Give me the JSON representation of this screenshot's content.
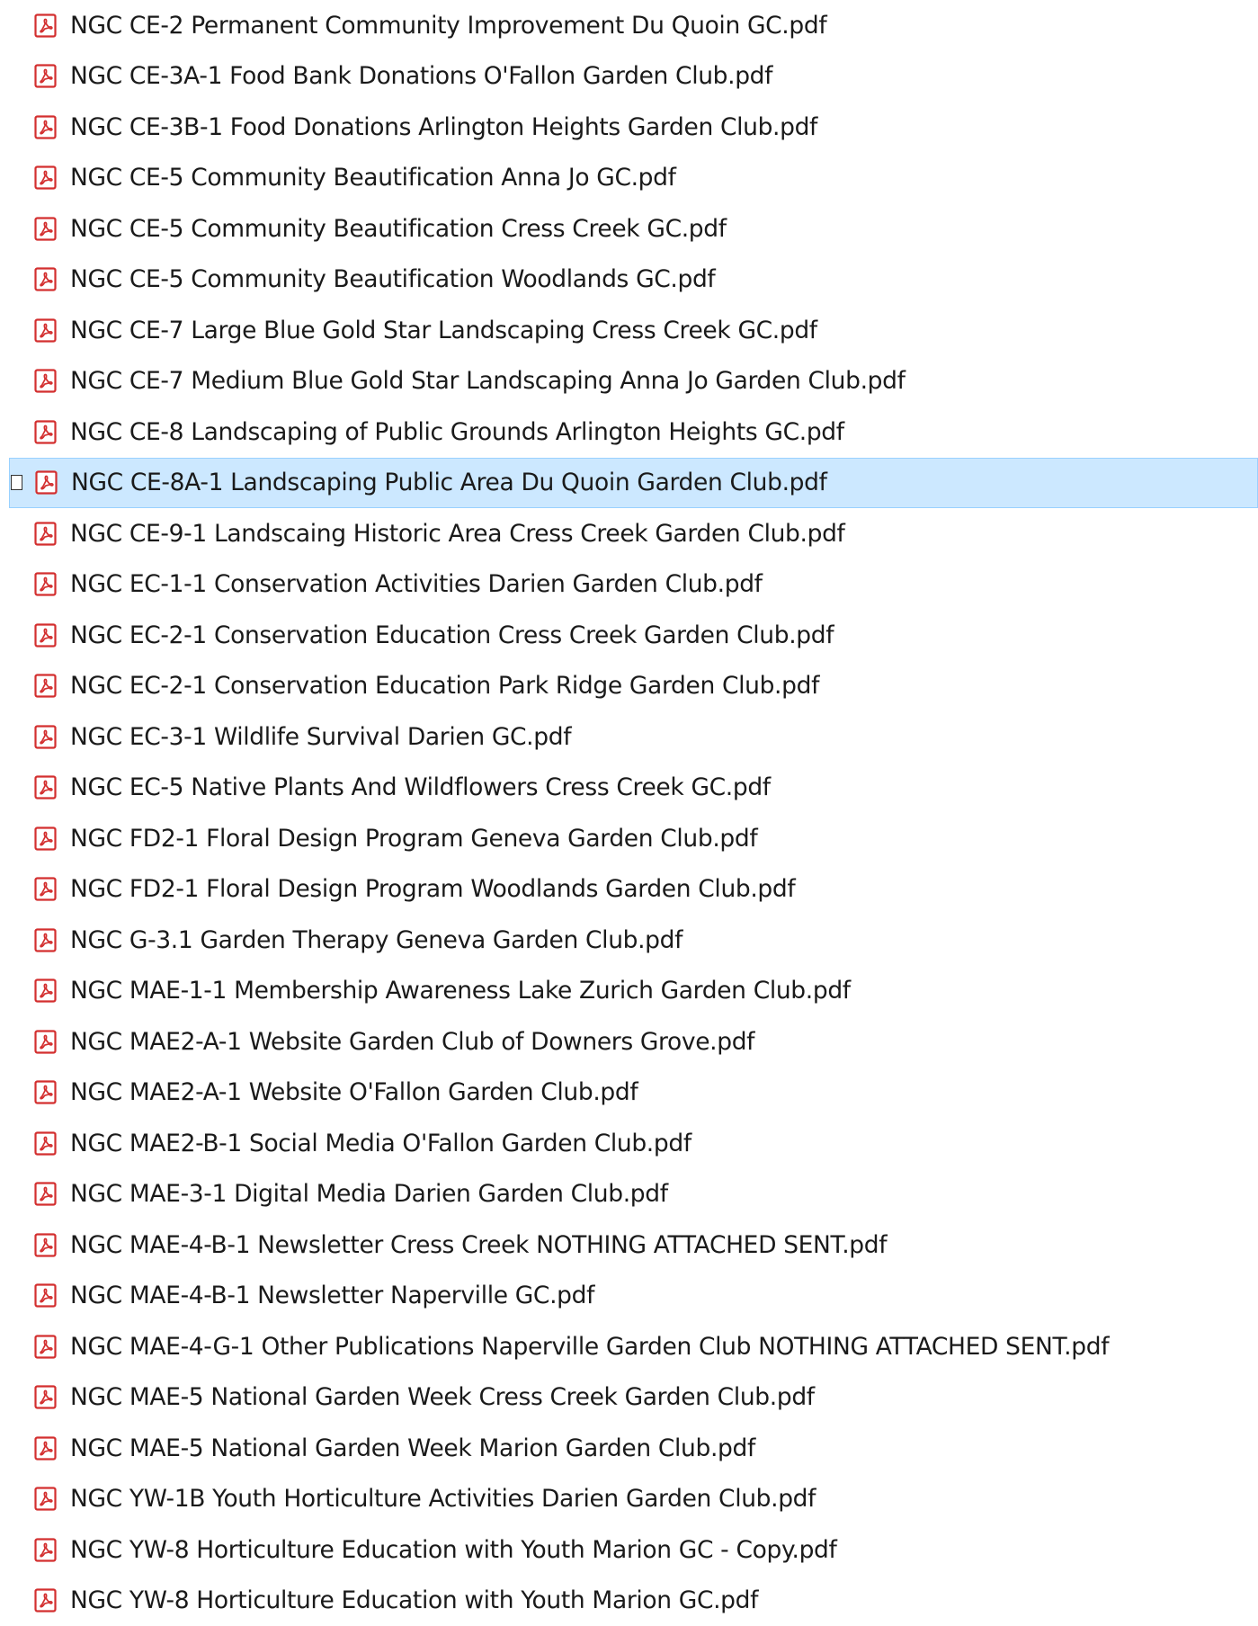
{
  "colors": {
    "selection_background": "#cce8ff",
    "selection_border": "#99d1ff",
    "pdf_icon": "#d32f2f",
    "text": "#1a1a1a"
  },
  "selected_index": 9,
  "files": [
    {
      "name": "NGC CE-2 Permanent Community Improvement Du Quoin GC.pdf",
      "icon": "pdf-icon"
    },
    {
      "name": "NGC CE-3A-1 Food Bank Donations O'Fallon Garden Club.pdf",
      "icon": "pdf-icon"
    },
    {
      "name": "NGC CE-3B-1 Food Donations Arlington Heights Garden Club.pdf",
      "icon": "pdf-icon"
    },
    {
      "name": "NGC CE-5 Community Beautification Anna Jo GC.pdf",
      "icon": "pdf-icon"
    },
    {
      "name": "NGC CE-5 Community Beautification Cress Creek GC.pdf",
      "icon": "pdf-icon"
    },
    {
      "name": "NGC CE-5 Community Beautification Woodlands GC.pdf",
      "icon": "pdf-icon"
    },
    {
      "name": "NGC CE-7 Large Blue Gold Star Landscaping Cress Creek GC.pdf",
      "icon": "pdf-icon"
    },
    {
      "name": "NGC CE-7 Medium Blue Gold Star Landscaping Anna Jo Garden Club.pdf",
      "icon": "pdf-icon"
    },
    {
      "name": "NGC CE-8 Landscaping of Public Grounds Arlington Heights GC.pdf",
      "icon": "pdf-icon"
    },
    {
      "name": "NGC CE-8A-1 Landscaping Public Area Du Quoin Garden Club.pdf",
      "icon": "pdf-icon"
    },
    {
      "name": "NGC CE-9-1 Landscaing Historic Area Cress Creek Garden Club.pdf",
      "icon": "pdf-icon"
    },
    {
      "name": "NGC EC-1-1 Conservation Activities Darien Garden Club.pdf",
      "icon": "pdf-icon"
    },
    {
      "name": "NGC EC-2-1 Conservation Education Cress Creek Garden Club.pdf",
      "icon": "pdf-icon"
    },
    {
      "name": "NGC EC-2-1 Conservation Education Park Ridge Garden Club.pdf",
      "icon": "pdf-icon"
    },
    {
      "name": "NGC EC-3-1 Wildlife Survival Darien GC.pdf",
      "icon": "pdf-icon"
    },
    {
      "name": "NGC EC-5 Native Plants And Wildflowers Cress Creek GC.pdf",
      "icon": "pdf-icon"
    },
    {
      "name": "NGC FD2-1 Floral Design Program Geneva Garden Club.pdf",
      "icon": "pdf-icon"
    },
    {
      "name": "NGC FD2-1 Floral Design Program Woodlands Garden Club.pdf",
      "icon": "pdf-icon"
    },
    {
      "name": "NGC G-3.1 Garden Therapy Geneva Garden Club.pdf",
      "icon": "pdf-icon"
    },
    {
      "name": "NGC MAE-1-1 Membership Awareness Lake Zurich Garden Club.pdf",
      "icon": "pdf-icon"
    },
    {
      "name": "NGC MAE2-A-1 Website Garden Club of Downers Grove.pdf",
      "icon": "pdf-icon"
    },
    {
      "name": "NGC MAE2-A-1 Website O'Fallon Garden Club.pdf",
      "icon": "pdf-icon"
    },
    {
      "name": "NGC MAE2-B-1 Social Media O'Fallon Garden Club.pdf",
      "icon": "pdf-icon"
    },
    {
      "name": "NGC MAE-3-1 Digital Media Darien Garden Club.pdf",
      "icon": "pdf-icon"
    },
    {
      "name": "NGC MAE-4-B-1 Newsletter Cress Creek NOTHING ATTACHED SENT.pdf",
      "icon": "pdf-icon"
    },
    {
      "name": "NGC MAE-4-B-1 Newsletter Naperville GC.pdf",
      "icon": "pdf-icon"
    },
    {
      "name": "NGC MAE-4-G-1 Other Publications Naperville Garden Club NOTHING ATTACHED SENT.pdf",
      "icon": "pdf-icon"
    },
    {
      "name": "NGC MAE-5 National Garden Week Cress Creek Garden Club.pdf",
      "icon": "pdf-icon"
    },
    {
      "name": "NGC MAE-5 National Garden Week Marion Garden Club.pdf",
      "icon": "pdf-icon"
    },
    {
      "name": "NGC YW-1B Youth Horticulture Activities Darien Garden Club.pdf",
      "icon": "pdf-icon"
    },
    {
      "name": "NGC YW-8 Horticulture Education with Youth Marion GC - Copy.pdf",
      "icon": "pdf-icon"
    },
    {
      "name": "NGC YW-8 Horticulture Education with Youth Marion GC.pdf",
      "icon": "pdf-icon"
    }
  ]
}
